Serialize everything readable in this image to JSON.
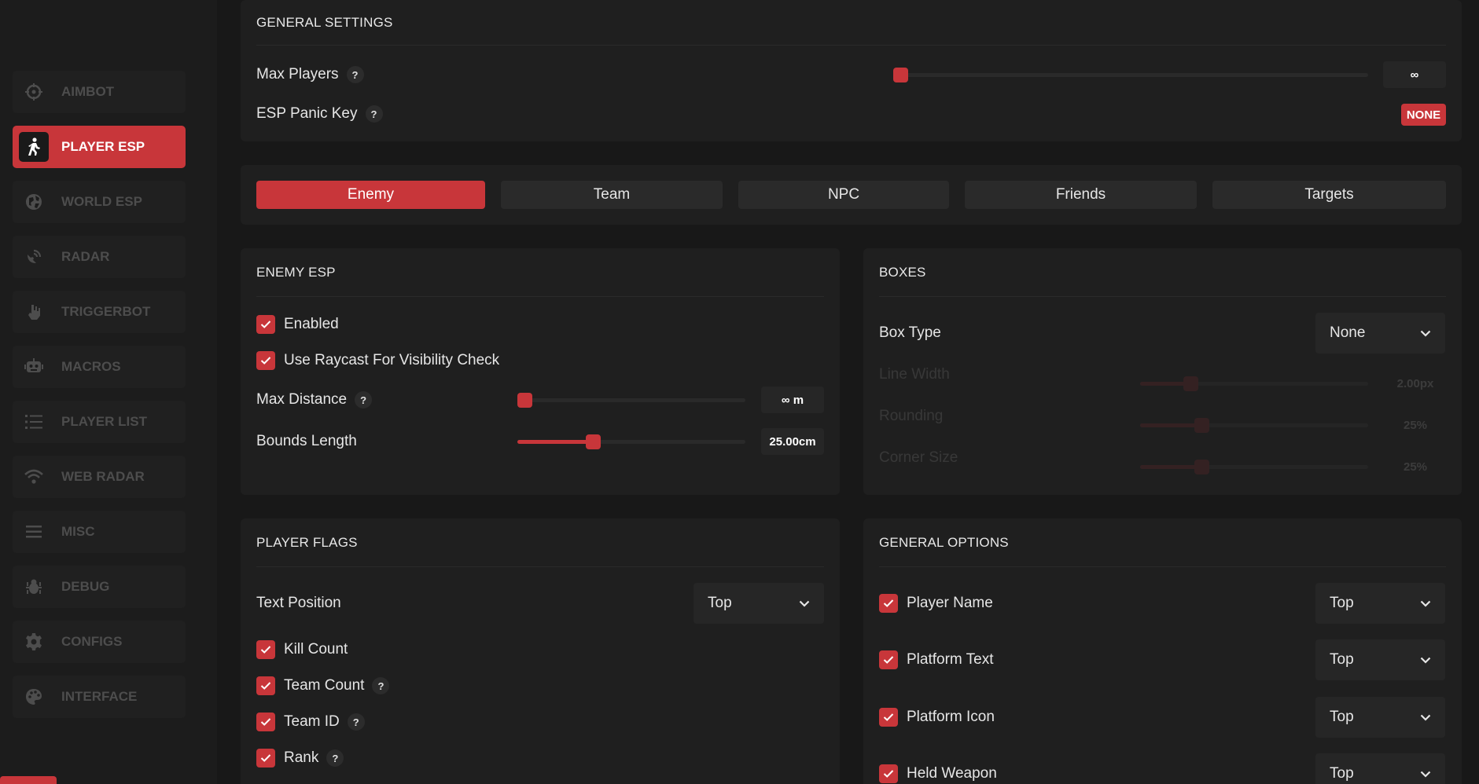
{
  "sidebar": {
    "items": [
      {
        "label": "AIMBOT",
        "icon": "crosshair-icon",
        "active": false
      },
      {
        "label": "PLAYER ESP",
        "icon": "walking-person-icon",
        "active": true
      },
      {
        "label": "WORLD ESP",
        "icon": "globe-icon",
        "active": false
      },
      {
        "label": "RADAR",
        "icon": "satellite-dish-icon",
        "active": false
      },
      {
        "label": "TRIGGERBOT",
        "icon": "hand-gun-icon",
        "active": false
      },
      {
        "label": "MACROS",
        "icon": "robot-icon",
        "active": false
      },
      {
        "label": "PLAYER LIST",
        "icon": "list-icon",
        "active": false
      },
      {
        "label": "WEB RADAR",
        "icon": "wifi-icon",
        "active": false
      },
      {
        "label": "MISC",
        "icon": "menu-icon",
        "active": false
      },
      {
        "label": "DEBUG",
        "icon": "bug-icon",
        "active": false
      },
      {
        "label": "CONFIGS",
        "icon": "gear-icon",
        "active": false
      },
      {
        "label": "INTERFACE",
        "icon": "palette-icon",
        "active": false
      }
    ]
  },
  "general": {
    "title": "GENERAL SETTINGS",
    "max_players_label": "Max Players",
    "max_players_value": "∞",
    "max_players_fraction": 0,
    "panic_key_label": "ESP Panic Key",
    "panic_key_value": "NONE"
  },
  "tabs": [
    {
      "label": "Enemy",
      "active": true
    },
    {
      "label": "Team",
      "active": false
    },
    {
      "label": "NPC",
      "active": false
    },
    {
      "label": "Friends",
      "active": false
    },
    {
      "label": "Targets",
      "active": false
    }
  ],
  "enemy_esp": {
    "title": "ENEMY ESP",
    "enabled_label": "Enabled",
    "enabled": true,
    "raycast_label": "Use Raycast For Visibility Check",
    "raycast": true,
    "max_distance_label": "Max Distance",
    "max_distance_value": "∞ m",
    "max_distance_fraction": 0,
    "bounds_length_label": "Bounds Length",
    "bounds_length_value": "25.00cm",
    "bounds_length_fraction": 0.33
  },
  "boxes": {
    "title": "BOXES",
    "box_type_label": "Box Type",
    "box_type_value": "None",
    "line_width_label": "Line Width",
    "line_width_value": "2.00px",
    "line_width_fraction": 0.22,
    "rounding_label": "Rounding",
    "rounding_value": "25%",
    "rounding_fraction": 0.27,
    "corner_size_label": "Corner Size",
    "corner_size_value": "25%",
    "corner_size_fraction": 0.27
  },
  "player_flags": {
    "title": "PLAYER FLAGS",
    "text_position_label": "Text Position",
    "text_position_value": "Top",
    "kill_count_label": "Kill Count",
    "team_count_label": "Team Count",
    "team_id_label": "Team ID",
    "rank_label": "Rank"
  },
  "general_options": {
    "title": "GENERAL OPTIONS",
    "items": [
      {
        "label": "Player Name",
        "value": "Top"
      },
      {
        "label": "Platform Text",
        "value": "Top"
      },
      {
        "label": "Platform Icon",
        "value": "Top"
      },
      {
        "label": "Held Weapon",
        "value": "Top"
      }
    ]
  },
  "help_glyph": "?",
  "colors": {
    "accent": "#c8363a",
    "panel": "#1f1f1f",
    "background": "#181818"
  }
}
